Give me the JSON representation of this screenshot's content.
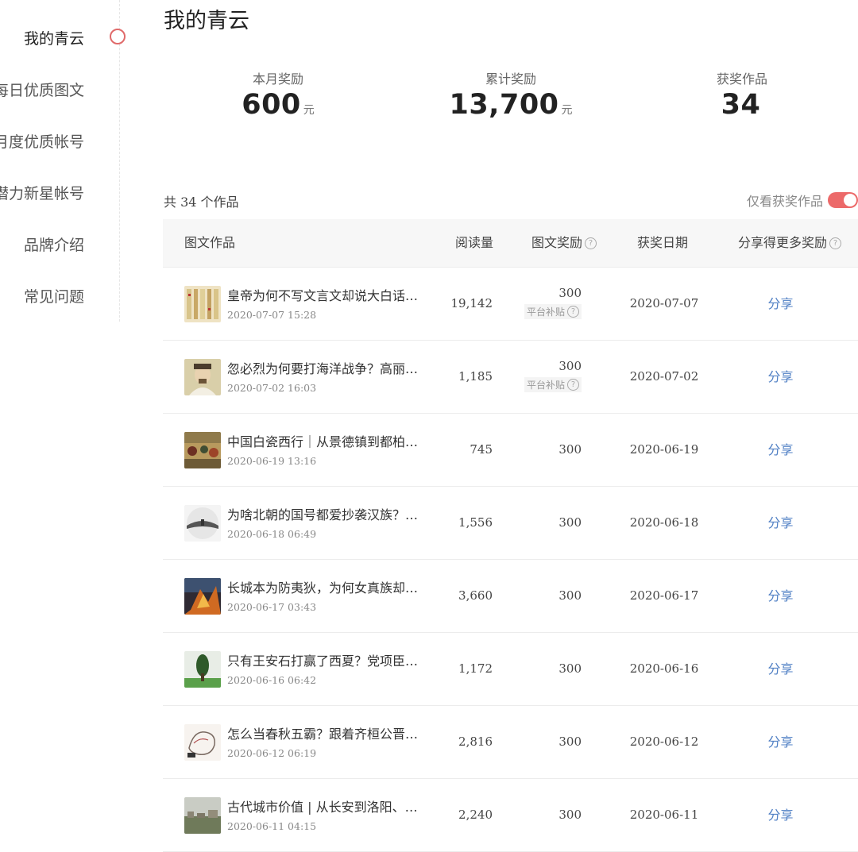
{
  "sidebar": {
    "items": [
      {
        "label": "我的青云",
        "active": true
      },
      {
        "label": "每日优质图文"
      },
      {
        "label": "月度优质帐号"
      },
      {
        "label": "潜力新星帐号"
      },
      {
        "label": "品牌介绍"
      },
      {
        "label": "常见问题"
      }
    ]
  },
  "page": {
    "title": "我的青云"
  },
  "stats": [
    {
      "label": "本月奖励",
      "value": "600",
      "unit": "元"
    },
    {
      "label": "累计奖励",
      "value": "13,700",
      "unit": "元"
    },
    {
      "label": "获奖作品",
      "value": "34",
      "unit": ""
    }
  ],
  "works": {
    "count_text": "共 34 个作品",
    "filter_label": "仅看获奖作品",
    "filter_on": true
  },
  "table": {
    "headers": {
      "work": "图文作品",
      "reads": "阅读量",
      "reward": "图文奖励",
      "date": "获奖日期",
      "share": "分享得更多奖励"
    },
    "help_icon": "?",
    "rows": [
      {
        "title": "皇帝为何不写文言文却说大白话…",
        "time": "2020-07-07 15:28",
        "reads": "19,142",
        "reward": "300",
        "subsidy": "平台补贴",
        "date": "2020-07-07",
        "share": "分享",
        "thumb_icon": "calligraphy-thumbnail"
      },
      {
        "title": "忽必烈为何要打海洋战争？高丽…",
        "time": "2020-07-02 16:03",
        "reads": "1,185",
        "reward": "300",
        "subsidy": "平台补贴",
        "date": "2020-07-02",
        "share": "分享",
        "thumb_icon": "portrait-thumbnail"
      },
      {
        "title": "中国白瓷西行｜从景德镇到都柏…",
        "time": "2020-06-19 13:16",
        "reads": "745",
        "reward": "300",
        "subsidy": "",
        "date": "2020-06-19",
        "share": "分享",
        "thumb_icon": "painting-thumbnail"
      },
      {
        "title": "为啥北朝的国号都爱抄袭汉族？…",
        "time": "2020-06-18 06:49",
        "reads": "1,556",
        "reward": "300",
        "subsidy": "",
        "date": "2020-06-18",
        "share": "分享",
        "thumb_icon": "landscape-thumbnail"
      },
      {
        "title": "长城本为防夷狄，为何女真族却…",
        "time": "2020-06-17 03:43",
        "reads": "3,660",
        "reward": "300",
        "subsidy": "",
        "date": "2020-06-17",
        "share": "分享",
        "thumb_icon": "battle-thumbnail"
      },
      {
        "title": "只有王安石打赢了西夏？党项臣…",
        "time": "2020-06-16 06:42",
        "reads": "1,172",
        "reward": "300",
        "subsidy": "",
        "date": "2020-06-16",
        "share": "分享",
        "thumb_icon": "tree-thumbnail"
      },
      {
        "title": "怎么当春秋五霸？跟着齐桓公晋…",
        "time": "2020-06-12 06:19",
        "reads": "2,816",
        "reward": "300",
        "subsidy": "",
        "date": "2020-06-12",
        "share": "分享",
        "thumb_icon": "sketch-thumbnail"
      },
      {
        "title": "古代城市价值 | 从长安到洛阳、…",
        "time": "2020-06-11 04:15",
        "reads": "2,240",
        "reward": "300",
        "subsidy": "",
        "date": "2020-06-11",
        "share": "分享",
        "thumb_icon": "city-thumbnail"
      }
    ]
  }
}
